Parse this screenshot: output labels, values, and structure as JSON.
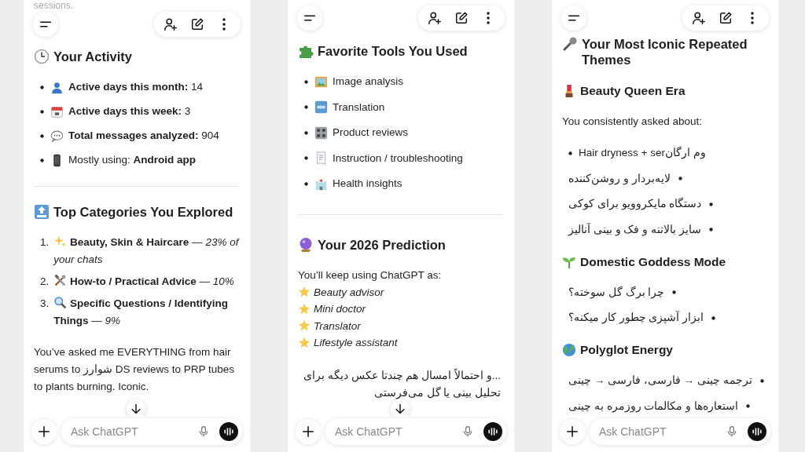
{
  "screens": [
    {
      "scroll_down_button": true,
      "composer": {
        "placeholder": "Ask ChatGPT"
      },
      "blocks": [
        {
          "kind": "faded",
          "text": "sessions."
        },
        {
          "kind": "heading",
          "text": "Your Activity"
        },
        {
          "kind": "bullets",
          "items": [
            {
              "text": "**Active days this month:** 14"
            },
            {
              "text": "**Active days this week:** 3"
            },
            {
              "text": "**Total messages analyzed:** 904"
            },
            {
              "text": "Mostly using: **Android app**"
            }
          ]
        },
        {
          "kind": "divider"
        },
        {
          "kind": "heading",
          "text": "Top Categories You Explored"
        },
        {
          "kind": "numbered",
          "items": [
            {
              "number": "1.",
              "text": "**Beauty, Skin & Haircare** — *23% of your chats*"
            },
            {
              "number": "2.",
              "text": "**How-to / Practical Advice** — *10%*"
            },
            {
              "number": "3.",
              "text": "**Specific Questions / Identifying Things** — *9%*"
            }
          ]
        },
        {
          "kind": "paragraph",
          "text": "You’ve asked me EVERYTHING from hair serums to شوارز DS reviews to PRP tubes to plants burning. Iconic."
        }
      ]
    },
    {
      "scroll_down_button": true,
      "composer": {
        "placeholder": "Ask ChatGPT"
      },
      "blocks": [
        {
          "kind": "heading",
          "text": "Favorite Tools You Used"
        },
        {
          "kind": "bullets",
          "items": [
            {
              "text": "Image analysis"
            },
            {
              "text": "Translation"
            },
            {
              "text": "Product reviews"
            },
            {
              "text": "Instruction / troubleshooting"
            },
            {
              "text": "Health insights"
            }
          ]
        },
        {
          "kind": "divider"
        },
        {
          "kind": "heading",
          "text": "Your 2026 Prediction"
        },
        {
          "kind": "starlist",
          "lead": "You’ll keep using ChatGPT as:",
          "items": [
            "Beauty advisor",
            "Mini doctor",
            "Translator",
            "Lifestyle assistant"
          ]
        },
        {
          "kind": "rtl_paragraph",
          "text": "...و احتمالاً امسال هم چندتا عکس دیگه برای تحلیل بینی یا گل می‌فرستی"
        }
      ]
    },
    {
      "scroll_down_button": false,
      "composer": {
        "placeholder": "Ask ChatGPT"
      },
      "blocks": [
        {
          "kind": "heading",
          "text": "Your Most Iconic Repeated Themes"
        },
        {
          "kind": "subheading",
          "text": "Beauty Queen Era"
        },
        {
          "kind": "paragraph",
          "text": "You consistently asked about:"
        },
        {
          "kind": "bullets",
          "items": [
            {
              "text": "Hair dryness + serوم ارگان"
            },
            {
              "text": "لایه‌بردار و روشن‌کننده",
              "rtl": true
            },
            {
              "text": "دستگاه مایکروویو برای کوکی",
              "rtl": true
            },
            {
              "text": "سایز بالاتنه و فک و بینی آنالیز",
              "rtl": true
            }
          ]
        },
        {
          "kind": "subheading",
          "text": "Domestic Goddess Mode"
        },
        {
          "kind": "bullets",
          "items": [
            {
              "text": "چرا برگ گل سوخته؟",
              "rtl": true
            },
            {
              "text": "ابزار آشپزی چطور کار میکنه؟",
              "rtl": true
            }
          ]
        },
        {
          "kind": "subheading",
          "text": "Polyglot Energy"
        },
        {
          "kind": "bullets",
          "items": [
            {
              "text": "ترجمه چینی → فارسی، فارسی → چینی",
              "rtl": true
            },
            {
              "text": "استعاره‌ها و مکالمات روزمره به چینی",
              "rtl": true
            }
          ]
        }
      ]
    }
  ]
}
